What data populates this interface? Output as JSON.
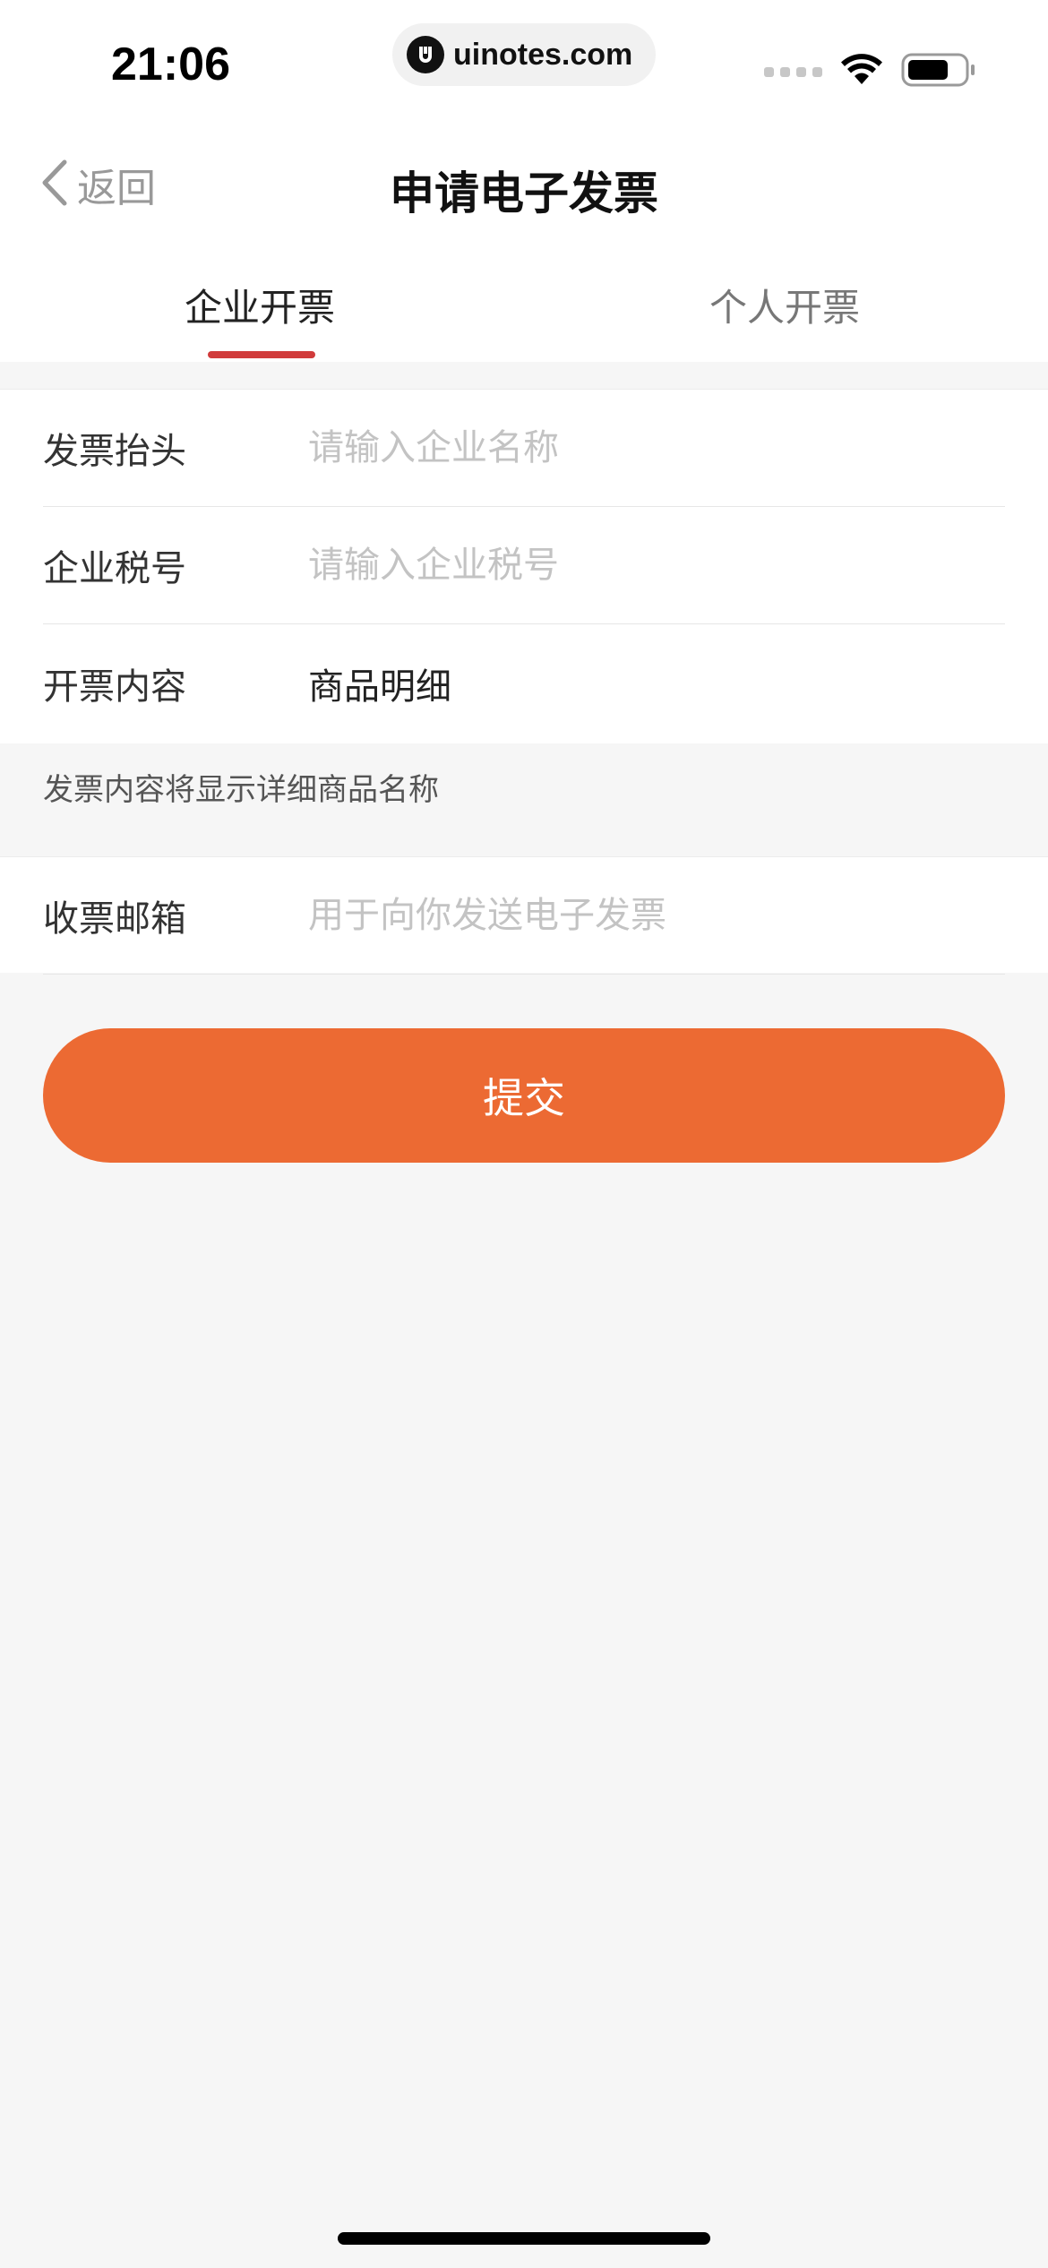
{
  "status_bar": {
    "time": "21:06",
    "url": "uinotes.com",
    "icons": [
      "signal-icon",
      "wifi-icon",
      "battery-icon"
    ]
  },
  "nav": {
    "back_label": "返回",
    "title": "申请电子发票"
  },
  "tabs": [
    {
      "label": "企业开票",
      "active": true
    },
    {
      "label": "个人开票",
      "active": false
    }
  ],
  "form": {
    "invoice_title": {
      "label": "发票抬头",
      "placeholder": "请输入企业名称",
      "value": ""
    },
    "tax_id": {
      "label": "企业税号",
      "placeholder": "请输入企业税号",
      "value": ""
    },
    "content": {
      "label": "开票内容",
      "value": "商品明细"
    },
    "hint": "发票内容将显示详细商品名称",
    "email": {
      "label": "收票邮箱",
      "placeholder": "用于向你发送电子发票",
      "value": ""
    }
  },
  "submit_label": "提交",
  "colors": {
    "accent": "#ec6a33",
    "tab_indicator": "#d13b3b",
    "background": "#f6f6f6"
  }
}
